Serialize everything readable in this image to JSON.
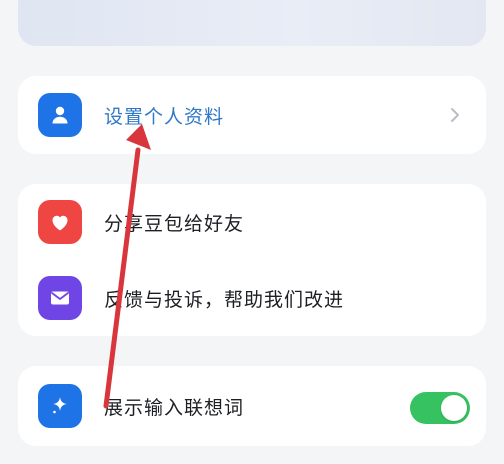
{
  "profile": {
    "label": "设置个人资料",
    "icon": "person-icon",
    "accent": "#1e73e6"
  },
  "actions": [
    {
      "label": "分享豆包给好友",
      "icon": "heart-icon",
      "accent": "#ef4543"
    },
    {
      "label": "反馈与投诉，帮助我们改进",
      "icon": "mail-icon",
      "accent": "#7045e6"
    }
  ],
  "settings": {
    "label": "展示输入联想词",
    "icon": "sparkle-icon",
    "accent": "#1e73e6",
    "toggle_on": true,
    "toggle_color": "#36c261"
  },
  "annotation": {
    "arrow_color": "#d8363c"
  }
}
